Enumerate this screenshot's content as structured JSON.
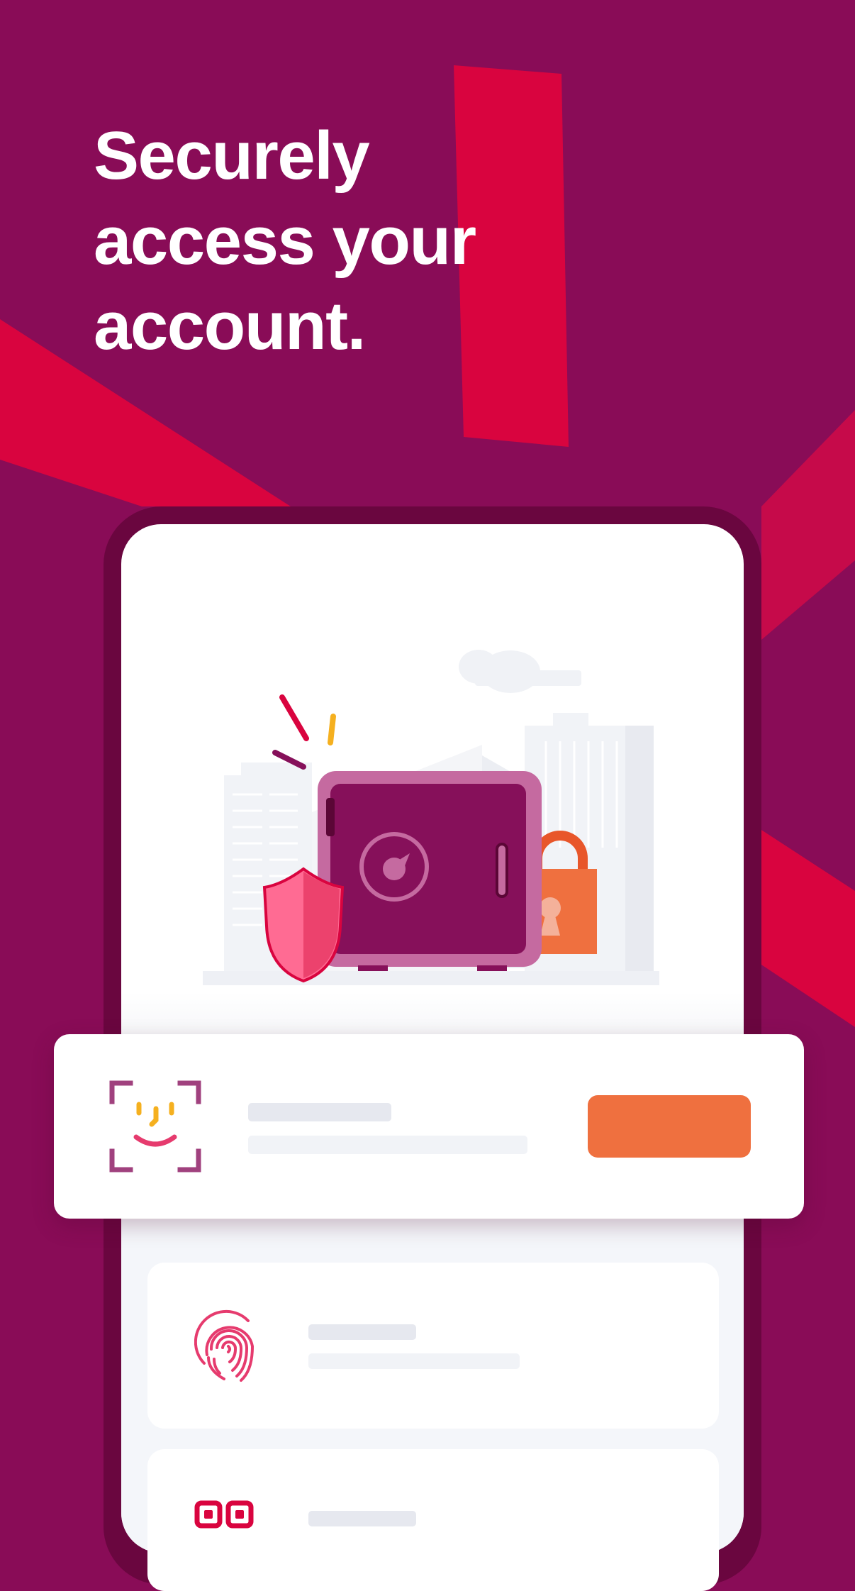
{
  "headline": {
    "lines": [
      "Securely",
      "access your",
      "account."
    ]
  },
  "colors": {
    "background": "#890c57",
    "stripe": "#d9043f",
    "phone_frame": "#6a063f",
    "screen": "#ffffff",
    "safe": "#86105a",
    "safe_border": "#c56aa0",
    "shield": "#ee4a73",
    "padlock": "#ef703f",
    "action_button": "#ef703f",
    "icon_accent_yellow": "#f5b01f",
    "icon_accent_pink": "#e63b6e",
    "icon_frame_purple": "#a0417e"
  },
  "icons": {
    "safe": "vault-safe-icon",
    "shield": "shield-icon",
    "padlock": "padlock-icon",
    "face_id": "face-id-icon",
    "fingerprint": "fingerprint-icon",
    "qr_code": "qr-code-icon"
  }
}
